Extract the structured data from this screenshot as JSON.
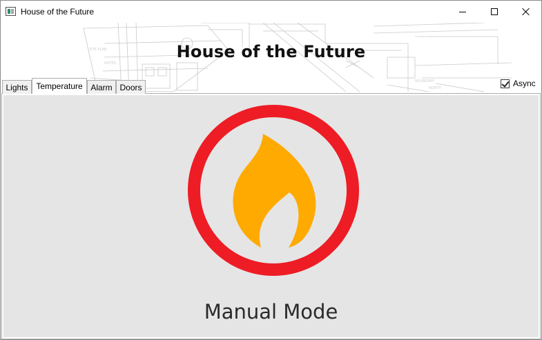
{
  "window": {
    "title": "House of the Future"
  },
  "header": {
    "heading": "House of the Future"
  },
  "tabs": [
    {
      "label": "Lights",
      "selected": false
    },
    {
      "label": "Temperature",
      "selected": true
    },
    {
      "label": "Alarm",
      "selected": false
    },
    {
      "label": "Doors",
      "selected": false
    }
  ],
  "options": {
    "async_label": "Async",
    "async_checked": true
  },
  "temperature": {
    "mode_label": "Manual Mode",
    "icon": "flame-icon",
    "colors": {
      "ring": "#ee1c25",
      "flame": "#ffaa00",
      "background": "#e5e5e5"
    }
  }
}
